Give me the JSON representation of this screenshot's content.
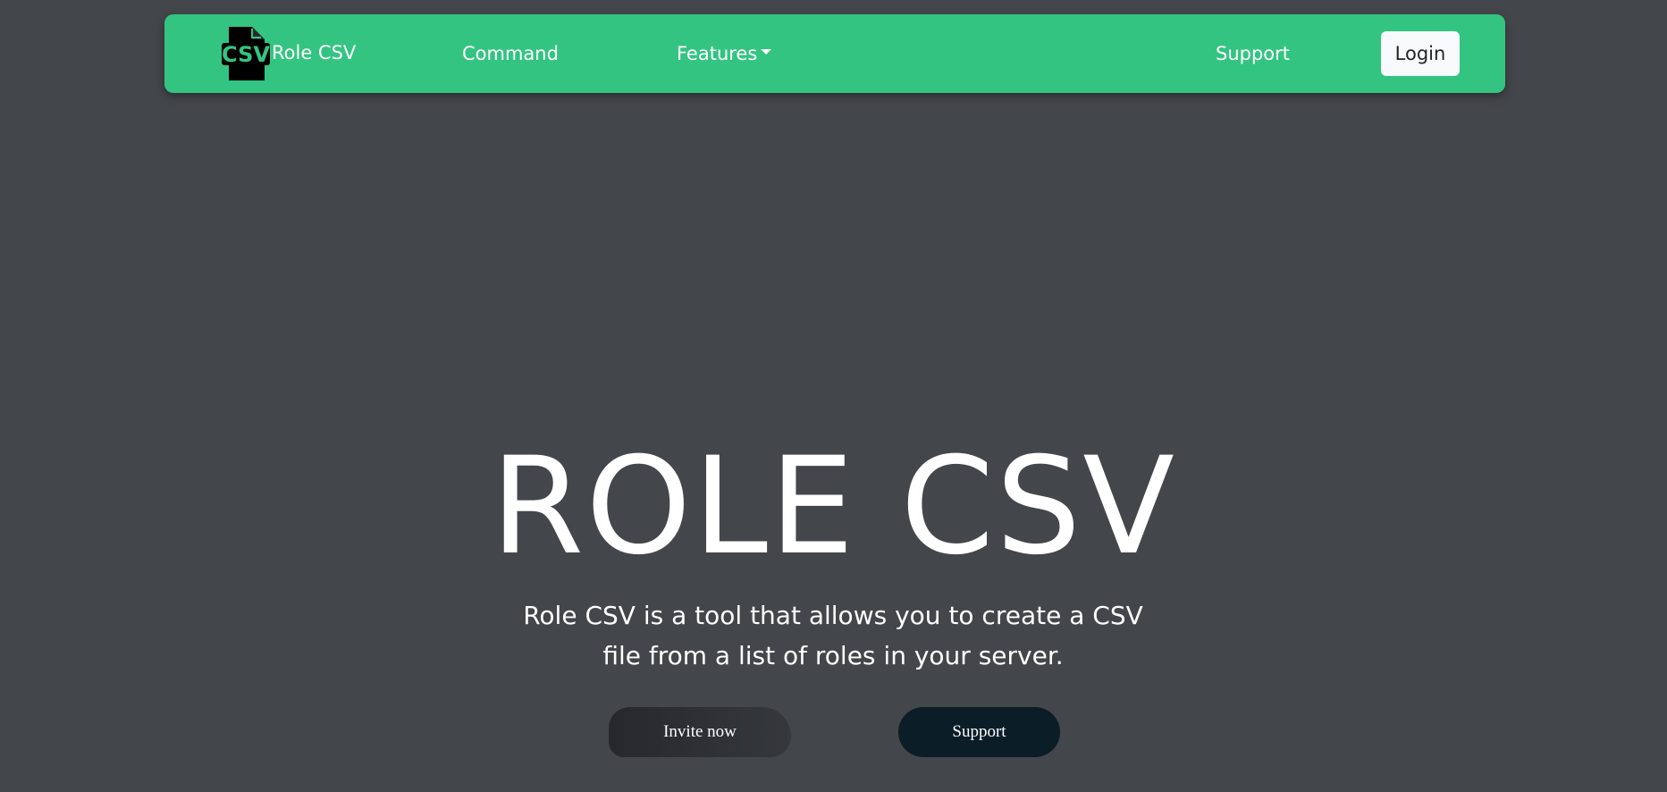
{
  "navbar": {
    "brand_logo_text": "CSV",
    "brand_label": "Role CSV",
    "links": {
      "command": "Command",
      "features": "Features",
      "support": "Support"
    },
    "login_label": "Login"
  },
  "hero": {
    "title": "ROLE CSV",
    "description": "Role CSV is a tool that allows you to create a CSV file from a list of roles in your server.",
    "buttons": {
      "invite": "Invite now",
      "support": "Support"
    }
  },
  "colors": {
    "page_background": "#43464b",
    "navbar_accent": "#33c482",
    "invite_button": "#2b2d31",
    "support_button": "#0b1d27"
  },
  "icons": {
    "brand": "csv-file-icon",
    "features_dropdown": "caret-down-icon"
  }
}
